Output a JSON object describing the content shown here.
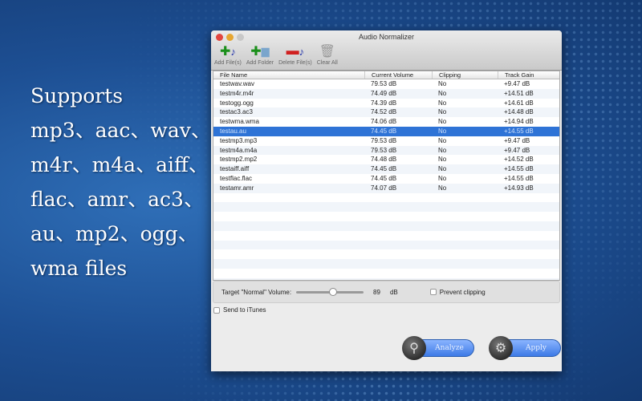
{
  "promo": [
    "Supports",
    "mp3、aac、wav、",
    "m4r、m4a、aiff、",
    "flac、amr、ac3、",
    "au、mp2、ogg、",
    "wma files"
  ],
  "window": {
    "title": "Audio Normalizer"
  },
  "toolbar": {
    "add_files": "Add File(s)",
    "add_folder": "Add Folder",
    "delete_files": "Delete File(s)",
    "clear_all": "Clear All"
  },
  "table": {
    "headers": [
      "File Name",
      "Current Volume",
      "Clipping",
      "Track Gain"
    ],
    "rows": [
      [
        "testwav.wav",
        "79.53 dB",
        "No",
        "+9.47 dB"
      ],
      [
        "testm4r.m4r",
        "74.49 dB",
        "No",
        "+14.51 dB"
      ],
      [
        "testogg.ogg",
        "74.39 dB",
        "No",
        "+14.61 dB"
      ],
      [
        "testac3.ac3",
        "74.52 dB",
        "No",
        "+14.48 dB"
      ],
      [
        "testwma.wma",
        "74.06 dB",
        "No",
        "+14.94 dB"
      ],
      [
        "testau.au",
        "74.45 dB",
        "No",
        "+14.55 dB"
      ],
      [
        "testmp3.mp3",
        "79.53 dB",
        "No",
        "+9.47 dB"
      ],
      [
        "testm4a.m4a",
        "79.53 dB",
        "No",
        "+9.47 dB"
      ],
      [
        "testmp2.mp2",
        "74.48 dB",
        "No",
        "+14.52 dB"
      ],
      [
        "testaiff.aiff",
        "74.45 dB",
        "No",
        "+14.55 dB"
      ],
      [
        "testflac.flac",
        "74.45 dB",
        "No",
        "+14.55 dB"
      ],
      [
        "testamr.amr",
        "74.07 dB",
        "No",
        "+14.93 dB"
      ]
    ],
    "selected_index": 5
  },
  "controls": {
    "target_label": "Target \"Normal\" Volume:",
    "target_value": "89",
    "unit": "dB",
    "slider_fraction": 0.55,
    "prevent_clipping": "Prevent clipping",
    "send_itunes": "Send to iTunes",
    "analyze": "Analyze",
    "apply": "Apply"
  }
}
